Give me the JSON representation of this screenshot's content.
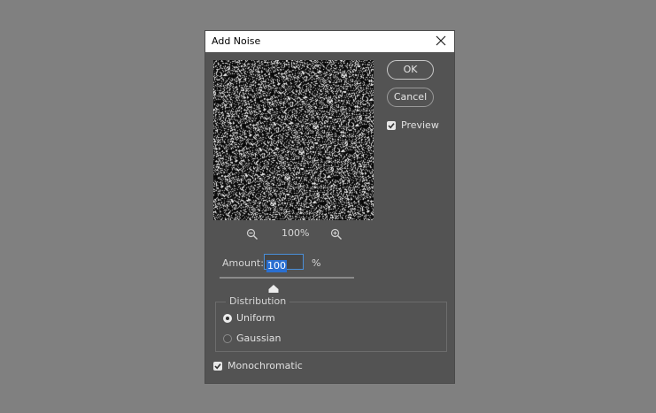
{
  "dialog": {
    "title": "Add Noise",
    "close_label": "Close"
  },
  "buttons": {
    "ok": "OK",
    "cancel": "Cancel"
  },
  "preview_checkbox": {
    "label": "Preview",
    "checked": true
  },
  "zoom": {
    "level": "100%",
    "zoom_out_icon": "zoom-out-icon",
    "zoom_in_icon": "zoom-in-icon"
  },
  "amount": {
    "label": "Amount:",
    "value": "100",
    "unit": "%",
    "slider_fraction": 0.4
  },
  "distribution": {
    "legend": "Distribution",
    "options": [
      {
        "label": "Uniform",
        "selected": true
      },
      {
        "label": "Gaussian",
        "selected": false
      }
    ]
  },
  "monochromatic": {
    "label": "Monochromatic",
    "checked": true
  },
  "colors": {
    "background": "#808080",
    "dialog": "#535353",
    "accent": "#2a6fd1"
  }
}
